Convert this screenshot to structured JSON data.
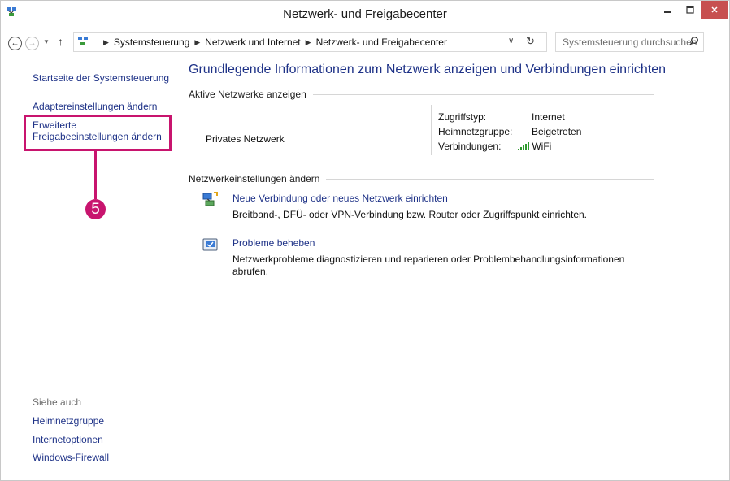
{
  "window": {
    "title": "Netzwerk- und Freigabecenter"
  },
  "nav": {
    "breadcrumbs": [
      "Systemsteuerung",
      "Netzwerk und Internet",
      "Netzwerk- und Freigabecenter"
    ],
    "search_placeholder": "Systemsteuerung durchsuchen"
  },
  "sidebar": {
    "home": "Startseite der Systemsteuerung",
    "adapter": "Adaptereinstellungen ändern",
    "sharing_line1": "Erweiterte",
    "sharing_line2": "Freigabeeinstellungen ändern",
    "see_also": "Siehe auch",
    "links": [
      "Heimnetzgruppe",
      "Internetoptionen",
      "Windows-Firewall"
    ]
  },
  "callout": {
    "number": "5",
    "color": "#c8146e"
  },
  "main": {
    "title": "Grundlegende Informationen zum Netzwerk anzeigen und Verbindungen einrichten",
    "active_label": "Aktive Netzwerke anzeigen",
    "network_name": "Privates Netzwerk",
    "access_type_label": "Zugriffstyp:",
    "access_type_value": "Internet",
    "homegroup_label": "Heimnetzgruppe:",
    "homegroup_value": "Beigetreten",
    "connections_label": "Verbindungen:",
    "connections_value": "WiFi",
    "change_label": "Netzwerkeinstellungen ändern",
    "items": [
      {
        "title": "Neue Verbindung oder neues Netzwerk einrichten",
        "desc": "Breitband-, DFÜ- oder VPN-Verbindung bzw. Router oder Zugriffspunkt einrichten."
      },
      {
        "title": "Probleme beheben",
        "desc": "Netzwerkprobleme diagnostizieren und reparieren oder Problembehandlungsinformationen abrufen."
      }
    ]
  },
  "colors": {
    "link": "#1e3287",
    "accent": "#c8146e",
    "close_button": "#c75050"
  }
}
